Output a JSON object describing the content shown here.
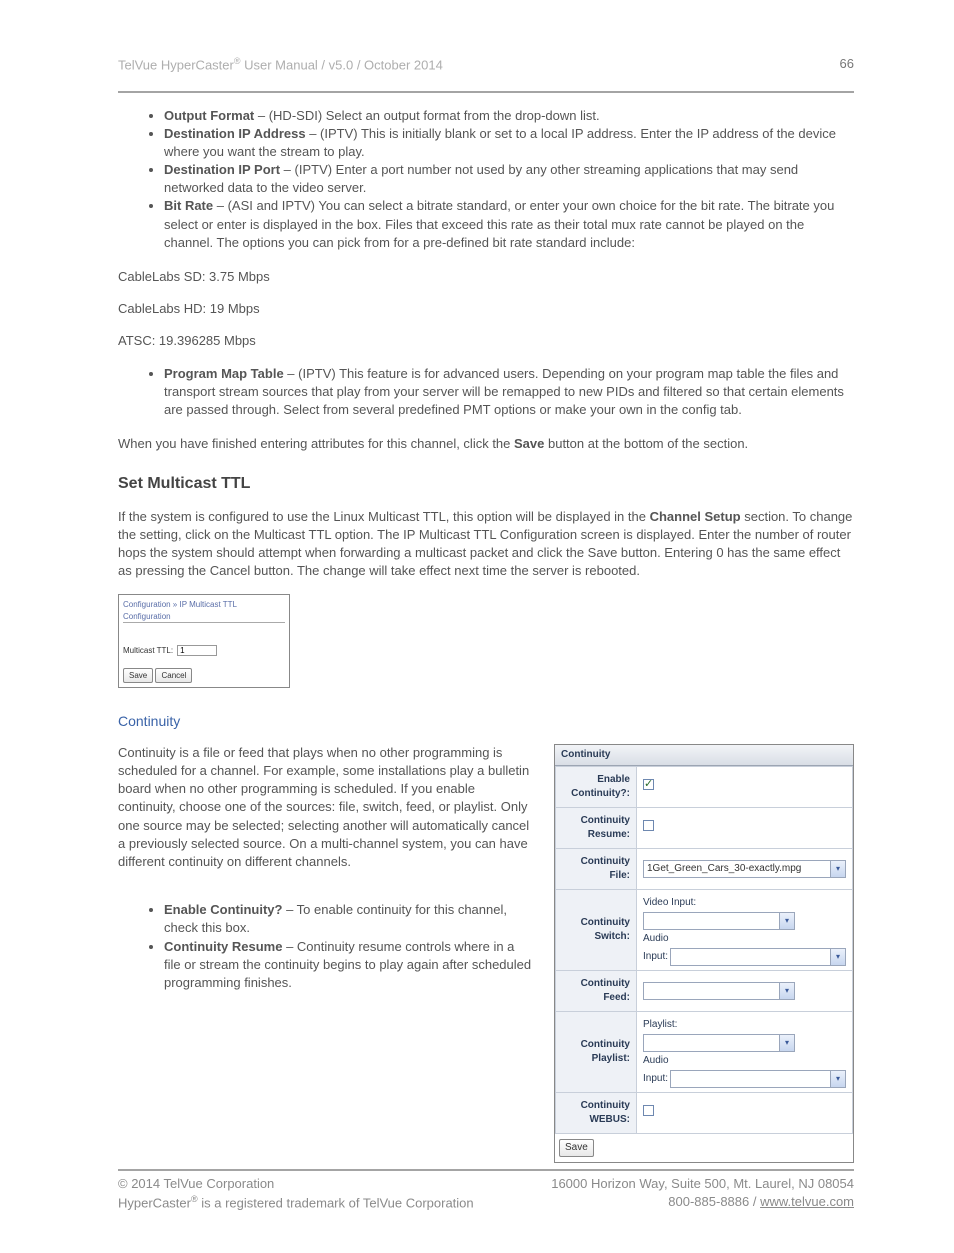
{
  "header": {
    "product": "TelVue HyperCaster",
    "reg_mark": "®",
    "doc": " User Manual  / v5.0 / October 2014",
    "page_no": "66"
  },
  "list1": {
    "output_format_b": "Output Format",
    "output_format_t": " – (HD-SDI) Select an output format from the drop-down list.",
    "dest_ip_b": "Destination IP Address",
    "dest_ip_t": " – (IPTV) This is initially blank or set to a local IP address.  Enter the IP address of the device where you want the stream to play.",
    "dest_port_b": "Destination IP Port",
    "dest_port_t": " – (IPTV) Enter a port number not used by any other streaming applications that may send networked data to the video server.",
    "bit_rate_b": "Bit Rate",
    "bit_rate_t": " – (ASI and IPTV) You can select a bitrate standard, or enter your own choice for the bit rate. The bitrate you select or enter is displayed in the box. Files that exceed this rate as their total mux rate cannot be played on the channel. The options you can pick from for a pre-defined bit rate standard include:"
  },
  "rates": {
    "sd": "CableLabs SD: 3.75 Mbps",
    "hd": "CableLabs HD: 19 Mbps",
    "atsc": "ATSC: 19.396285 Mbps"
  },
  "list2": {
    "pmt_b": "Program Map Table",
    "pmt_t": " – (IPTV) This feature is for advanced users.  Depending on your program map table the files and transport stream sources that play from your server will be remapped to new PIDs and filtered so that certain elements are passed through. Select from several predefined PMT options or make your own in the config tab."
  },
  "finish_pre": "When you have finished entering attributes for this channel, click the ",
  "finish_b": "Save",
  "finish_post": " button at the bottom of the section.",
  "multicast": {
    "title": "Set Multicast TTL",
    "p_pre": "If the system is configured to use the Linux Multicast TTL, this option will be displayed in the ",
    "p_b": "Channel Setup",
    "p_post": " section.  To change the setting, click on the Multicast TTL option.  The IP Multicast TTL Configuration screen is displayed. Enter the number of router hops the system should attempt when forwarding a multicast packet and click the Save button. Entering 0 has the same effect as pressing the Cancel button. The change will take effect next time the server is rebooted."
  },
  "fig1": {
    "crumb": "Configuration » IP Multicast TTL Configuration",
    "label": "Multicast TTL:",
    "value": "1",
    "save": "Save",
    "cancel": "Cancel"
  },
  "continuity": {
    "title": "Continuity",
    "para": "Continuity is a file or feed that plays when no other programming is scheduled for a channel. For example, some installations play a bulletin board when no other programming is scheduled.  If you enable continuity, choose one of the sources: file, switch, feed, or playlist.  Only one source may be selected; selecting another will automatically cancel a previously selected source.  On a multi-channel system, you can have different continuity on different channels.",
    "li1_b": "Enable Continuity?",
    "li1_t": " – To enable continuity for this channel, check this box.",
    "li2_b": "Continuity Resume",
    "li2_t": " – Continuity resume controls where in a file or stream the continuity begins to play again after scheduled programming finishes."
  },
  "fig2": {
    "panel_title": "Continuity",
    "rows": {
      "enable": "Enable Continuity?:",
      "resume": "Continuity Resume:",
      "file": "Continuity File:",
      "switch": "Continuity Switch:",
      "feed": "Continuity Feed:",
      "playlist": "Continuity Playlist:",
      "webus": "Continuity WEBUS:"
    },
    "file_value": "1Get_Green_Cars_30-exactly.mpg",
    "video_input": "Video Input:",
    "audio_input_pre": "Audio",
    "audio_input": "Input:",
    "playlist_lab": "Playlist:",
    "save": "Save"
  },
  "footer": {
    "left1": "© 2014 TelVue Corporation",
    "right1": "16000 Horizon Way, Suite 500, Mt. Laurel, NJ 08054",
    "left2_a": "HyperCaster",
    "left2_b": " is a registered trademark of TelVue Corporation",
    "right2_a": "800-885-8886  / ",
    "right2_link": "www.telvue.com"
  }
}
